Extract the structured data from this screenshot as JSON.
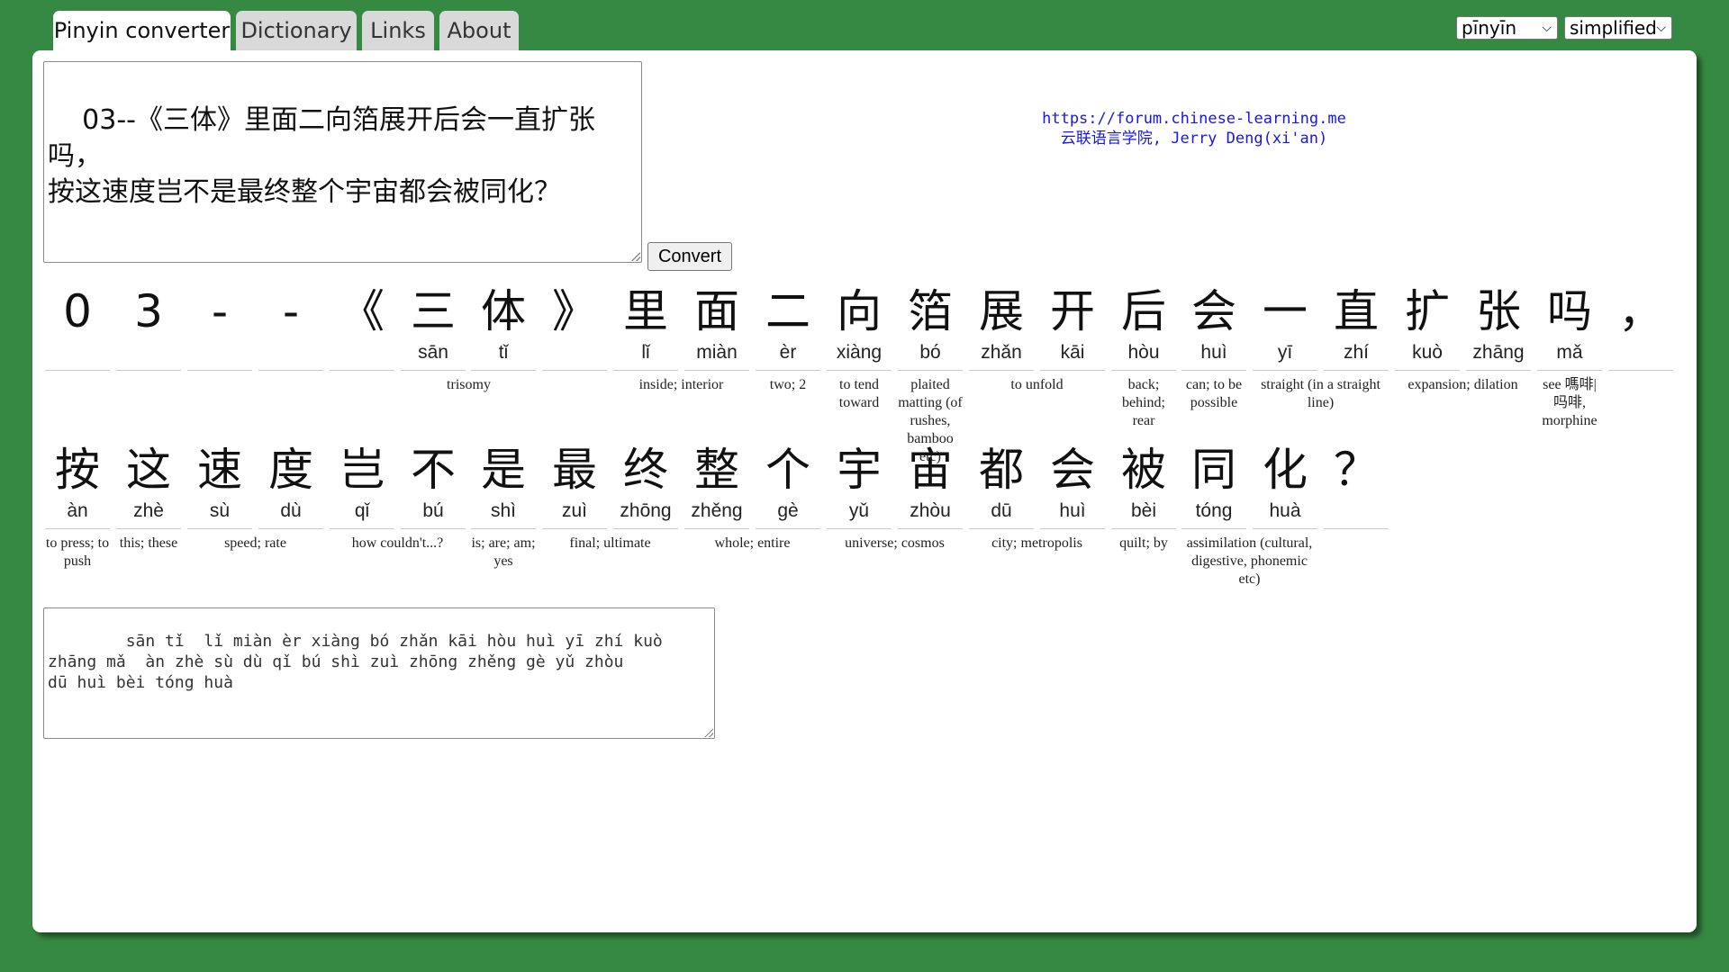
{
  "tabs": [
    {
      "label": "Pinyin converter",
      "active": true
    },
    {
      "label": "Dictionary"
    },
    {
      "label": "Links"
    },
    {
      "label": "About"
    }
  ],
  "selects": {
    "mode": {
      "value": "pīnyīn"
    },
    "script": {
      "value": "simplified"
    }
  },
  "input": {
    "text": "03--《三体》里面二向箔展开后会一直扩张吗，\n按这速度岂不是最终整个宇宙都会被同化？"
  },
  "convert_label": "Convert",
  "credit": {
    "line1": "https://forum.chinese-learning.me",
    "line2": "云联语言学院, Jerry Deng(xi'an)"
  },
  "row1": {
    "chars": [
      {
        "hz": "0",
        "py": ""
      },
      {
        "hz": "3",
        "py": ""
      },
      {
        "hz": "-",
        "py": ""
      },
      {
        "hz": "-",
        "py": ""
      },
      {
        "hz": "《",
        "py": ""
      },
      {
        "hz": "三",
        "py": "sān"
      },
      {
        "hz": "体",
        "py": "tǐ"
      },
      {
        "hz": "》",
        "py": ""
      },
      {
        "hz": "里",
        "py": "lǐ"
      },
      {
        "hz": "面",
        "py": "miàn"
      },
      {
        "hz": "二",
        "py": "èr"
      },
      {
        "hz": "向",
        "py": "xiàng"
      },
      {
        "hz": "箔",
        "py": "bó"
      },
      {
        "hz": "展",
        "py": "zhǎn"
      },
      {
        "hz": "开",
        "py": "kāi"
      },
      {
        "hz": "后",
        "py": "hòu"
      },
      {
        "hz": "会",
        "py": "huì"
      },
      {
        "hz": "一",
        "py": "yī"
      },
      {
        "hz": "直",
        "py": "zhí"
      },
      {
        "hz": "扩",
        "py": "kuò"
      },
      {
        "hz": "张",
        "py": "zhāng"
      },
      {
        "hz": "吗",
        "py": "mǎ"
      },
      {
        "hz": "，",
        "py": ""
      }
    ],
    "glosses": [
      {
        "text": "trisomy"
      },
      {
        "text": "inside; interior"
      },
      {
        "text": "two; 2"
      },
      {
        "text": "to tend toward"
      },
      {
        "text": "plaited matting (of rushes, bamboo etc)"
      },
      {
        "text": "to unfold"
      },
      {
        "text": "back; behind; rear"
      },
      {
        "text": "can; to be possible"
      },
      {
        "text": "straight (in a straight line)"
      },
      {
        "text": "expansion; dilation"
      },
      {
        "text": "see 嗎啡|吗啡, morphine"
      }
    ]
  },
  "row2": {
    "chars": [
      {
        "hz": "按",
        "py": "àn"
      },
      {
        "hz": "这",
        "py": "zhè"
      },
      {
        "hz": "速",
        "py": "sù"
      },
      {
        "hz": "度",
        "py": "dù"
      },
      {
        "hz": "岂",
        "py": "qǐ"
      },
      {
        "hz": "不",
        "py": "bú"
      },
      {
        "hz": "是",
        "py": "shì"
      },
      {
        "hz": "最",
        "py": "zuì"
      },
      {
        "hz": "终",
        "py": "zhōng"
      },
      {
        "hz": "整",
        "py": "zhěng"
      },
      {
        "hz": "个",
        "py": "gè"
      },
      {
        "hz": "宇",
        "py": "yǔ"
      },
      {
        "hz": "宙",
        "py": "zhòu"
      },
      {
        "hz": "都",
        "py": "dū"
      },
      {
        "hz": "会",
        "py": "huì"
      },
      {
        "hz": "被",
        "py": "bèi"
      },
      {
        "hz": "同",
        "py": "tóng"
      },
      {
        "hz": "化",
        "py": "huà"
      },
      {
        "hz": "？",
        "py": ""
      }
    ],
    "glosses": [
      {
        "text": "to press; to push"
      },
      {
        "text": "this; these"
      },
      {
        "text": "speed; rate"
      },
      {
        "text": "how couldn't...?"
      },
      {
        "text": "is; are; am; yes"
      },
      {
        "text": "final; ultimate"
      },
      {
        "text": "whole; entire"
      },
      {
        "text": "universe; cosmos"
      },
      {
        "text": "city; metropolis"
      },
      {
        "text": "quilt; by"
      },
      {
        "text": "assimilation (cultural, digestive, phonemic etc)"
      }
    ]
  },
  "output": {
    "text": "    sān tǐ  lǐ miàn èr xiàng bó zhǎn kāi hòu huì yī zhí kuò\nzhāng mǎ  àn zhè sù dù qǐ bú shì zuì zhōng zhěng gè yǔ zhòu\ndū huì bèi tóng huà"
  },
  "colors": {
    "background": "#368942",
    "panel": "#ffffff",
    "credit_link": "#1717e6"
  }
}
